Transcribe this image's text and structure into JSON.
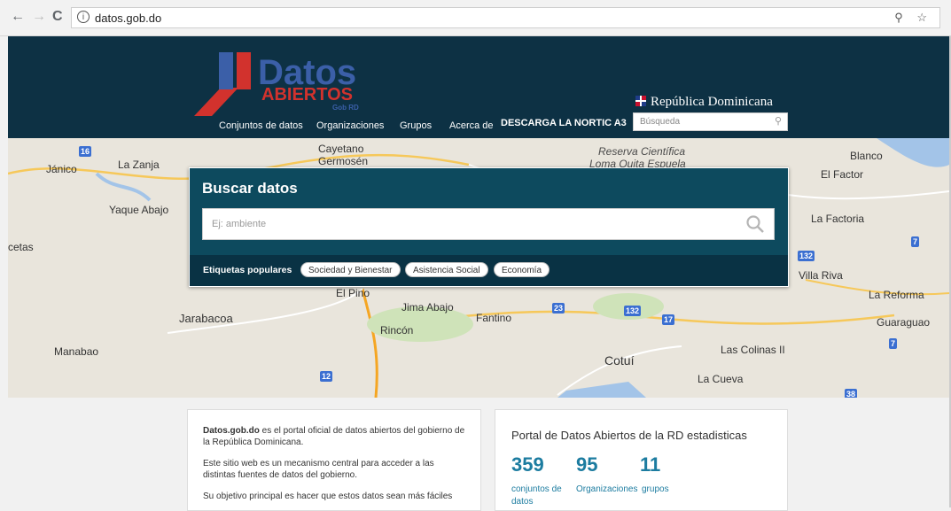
{
  "browser": {
    "back": "←",
    "forward": "→",
    "reload": "C",
    "info": "i",
    "url": "datos.gob.do",
    "right_icons": "⚲ ☆"
  },
  "header": {
    "logo_datos": "Datos",
    "logo_abiertos": "ABIERTOS",
    "logo_gobrd": "Gob RD",
    "nav": [
      "Conjuntos de datos",
      "Organizaciones",
      "Grupos",
      "Acerca de"
    ],
    "nortic": "DESCARGA LA NORTIC A3",
    "republica": "República Dominicana",
    "search_placeholder": "Búsqueda"
  },
  "map_labels": {
    "l1": "Jánico",
    "l2": "La Zanja",
    "l3": "Cayetano",
    "l4": "Germosén",
    "l5": "Reserva Científica",
    "l6": "Loma Quita Espuela",
    "l7": "Blanco",
    "l8": "El Factor",
    "l9": "Yaque Abajo",
    "l10": "cetas",
    "l11": "La Factoria",
    "l12": "Villa Riva",
    "l13": "La Reforma",
    "l14": "El Pino",
    "l15": "Jima Abajo",
    "l16": "Jarabacoa",
    "l17": "Fantino",
    "l18": "Rincón",
    "l19": "Guaraguao",
    "l20": "Manabao",
    "l21": "Cotuí",
    "l22": "Las Colinas II",
    "l23": "La Cueva",
    "s1": "16",
    "s2": "7",
    "s3": "132",
    "s4": "23",
    "s5": "132",
    "s6": "17",
    "s7": "7",
    "s8": "12",
    "s9": "38"
  },
  "search_panel": {
    "title": "Buscar datos",
    "placeholder": "Ej: ambiente",
    "tags_label": "Etiquetas populares",
    "tags": [
      "Sociedad y Bienestar",
      "Asistencia Social",
      "Economía"
    ]
  },
  "about": {
    "p1_strong": "Datos.gob.do",
    "p1_rest": " es el portal oficial de datos abiertos del gobierno de la República Dominicana.",
    "p2": "Este sitio web es un mecanismo central para acceder a las distintas fuentes de datos del gobierno.",
    "p3": "Su objetivo principal es hacer que estos datos sean más fáciles"
  },
  "stats": {
    "title": "Portal de Datos Abiertos de la RD estadisticas",
    "items": [
      {
        "value": "359",
        "label": "conjuntos de datos"
      },
      {
        "value": "95",
        "label": "Organizaciones"
      },
      {
        "value": "11",
        "label": "grupos"
      }
    ]
  },
  "colors": {
    "header_bg": "#0d3144",
    "panel_bg": "#0d4a5e",
    "logo_blue": "#3b5fa8",
    "logo_red": "#d2322d",
    "stat_blue": "#1c7ca0"
  }
}
